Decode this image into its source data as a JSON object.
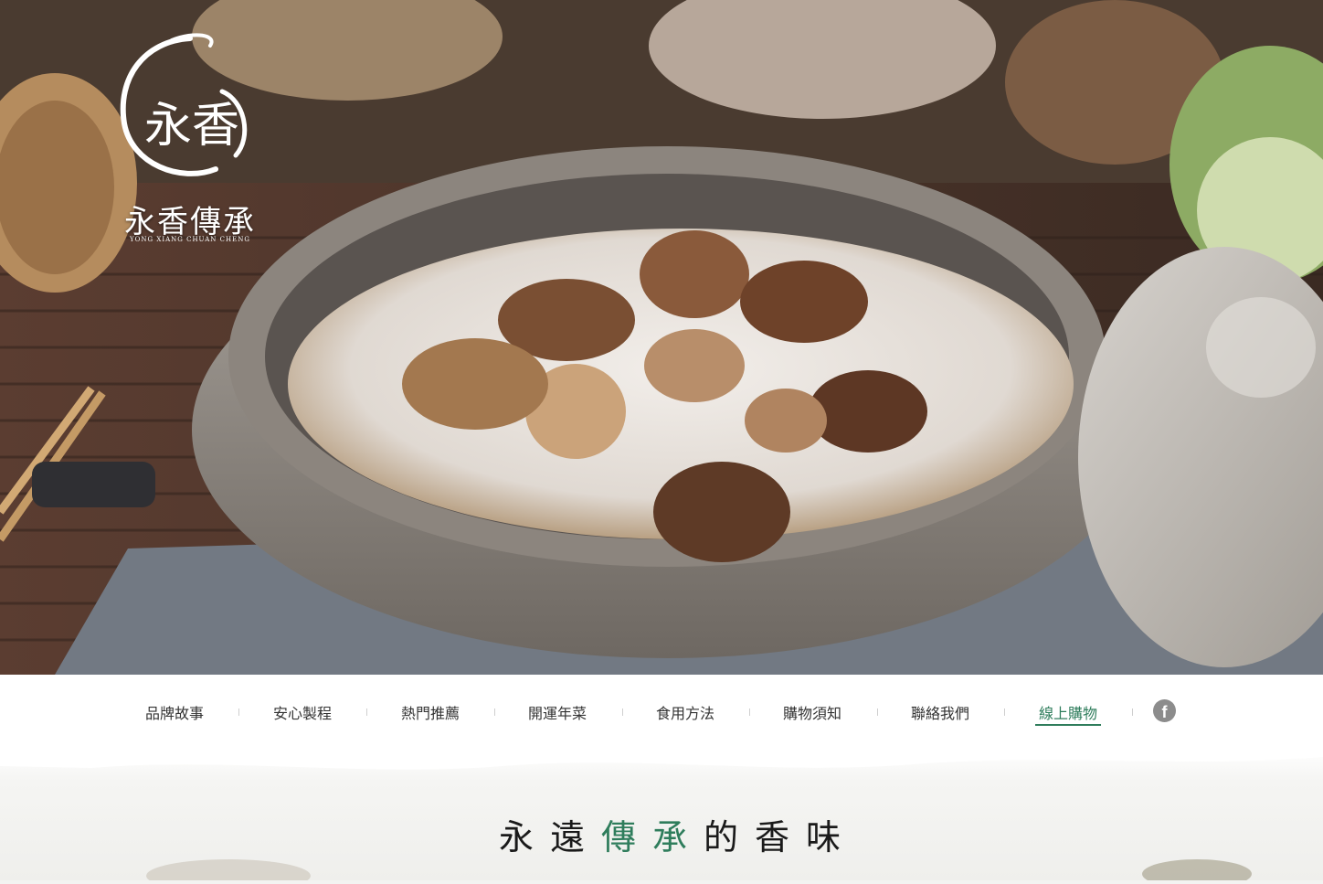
{
  "brand": {
    "name": "永香傳承",
    "romanization": "YONG XIANG CHUAN CHENG",
    "seal_text": "永香"
  },
  "nav": {
    "items": [
      {
        "label": "品牌故事"
      },
      {
        "label": "安心製程"
      },
      {
        "label": "熱門推薦"
      },
      {
        "label": "開運年菜"
      },
      {
        "label": "食用方法"
      },
      {
        "label": "購物須知"
      },
      {
        "label": "聯絡我們"
      },
      {
        "label": "線上購物",
        "active": true
      }
    ],
    "facebook_icon": "facebook-icon"
  },
  "tagline": {
    "part1": "永遠",
    "accent": "傳承",
    "part2": "的香味"
  },
  "colors": {
    "accent": "#2f7d5c",
    "nav_text": "#333333",
    "icon_gray": "#8c8c8c"
  }
}
